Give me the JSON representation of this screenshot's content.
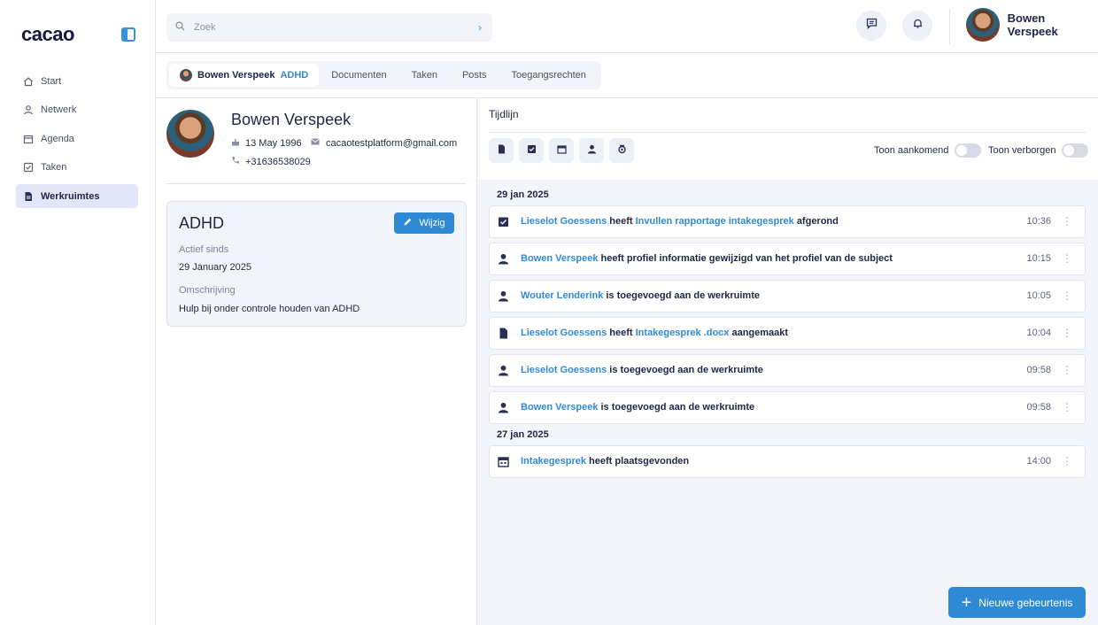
{
  "brand": {
    "logo": "cacao",
    "accent": "#2f8ad5"
  },
  "sidebar": {
    "items": [
      {
        "label": "Start",
        "icon": "home-icon"
      },
      {
        "label": "Netwerk",
        "icon": "user-icon"
      },
      {
        "label": "Agenda",
        "icon": "calendar-icon"
      },
      {
        "label": "Taken",
        "icon": "checkbox-icon"
      },
      {
        "label": "Werkruimtes",
        "icon": "document-icon",
        "active": true
      }
    ]
  },
  "topbar": {
    "search_placeholder": "Zoek",
    "user_name": "Bowen Verspeek"
  },
  "tabs": {
    "workspace_person": "Bowen Verspeek",
    "workspace_tag": "ADHD",
    "items": [
      "Documenten",
      "Taken",
      "Posts",
      "Toegangsrechten"
    ]
  },
  "profile": {
    "name": "Bowen Verspeek",
    "birthdate": "13 May 1996",
    "email": "cacaotestplatform@gmail.com",
    "phone": "+31636538029"
  },
  "workspace_card": {
    "title": "ADHD",
    "edit_label": "Wijzig",
    "active_since_label": "Actief sinds",
    "active_since_value": "29 January 2025",
    "description_label": "Omschrijving",
    "description_value": "Hulp bij onder controle houden van ADHD"
  },
  "timeline": {
    "title": "Tijdlijn",
    "filters": [
      "document-icon",
      "checkbox-icon",
      "calendar-icon",
      "user-icon",
      "tag-icon"
    ],
    "toggle_upcoming": "Toon aankomend",
    "toggle_hidden": "Toon verborgen",
    "groups": [
      {
        "date": "29 jan 2025",
        "events": [
          {
            "icon": "checkbox-icon",
            "actor": "Lieselot Goessens",
            "verb": "heeft",
            "object": "Invullen rapportage intakegesprek",
            "rest": "afgerond",
            "time": "10:36"
          },
          {
            "icon": "user-icon",
            "actor": "Bowen Verspeek",
            "verb": "heeft profiel informatie gewijzigd van het profiel van de subject",
            "object": "",
            "rest": "",
            "time": "10:15"
          },
          {
            "icon": "user-icon",
            "actor": "Wouter Lenderink",
            "verb": "is toegevoegd aan de werkruimte",
            "object": "",
            "rest": "",
            "time": "10:05"
          },
          {
            "icon": "document-icon",
            "actor": "Lieselot Goessens",
            "verb": "heeft",
            "object": "Intakegesprek .docx",
            "rest": "aangemaakt",
            "time": "10:04"
          },
          {
            "icon": "user-icon",
            "actor": "Lieselot Goessens",
            "verb": "is toegevoegd aan de werkruimte",
            "object": "",
            "rest": "",
            "time": "09:58"
          },
          {
            "icon": "user-icon",
            "actor": "Bowen Verspeek",
            "verb": "is toegevoegd aan de werkruimte",
            "object": "",
            "rest": "",
            "time": "09:58"
          }
        ]
      },
      {
        "date": "27 jan 2025",
        "events": [
          {
            "icon": "calendar-icon",
            "actor": "Intakegesprek",
            "verb": "heeft plaatsgevonden",
            "object": "",
            "rest": "",
            "time": "14:00"
          }
        ]
      }
    ]
  },
  "fab": {
    "label": "Nieuwe gebeurtenis"
  }
}
